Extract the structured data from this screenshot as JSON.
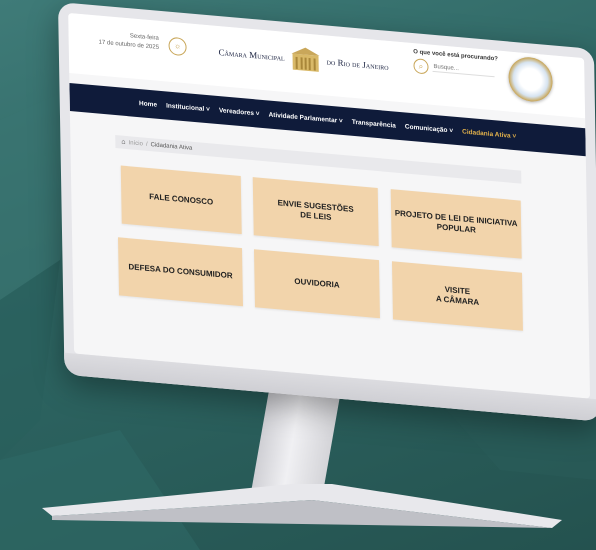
{
  "header": {
    "weekday": "Sexta-feira",
    "date": "17 de outubro de 2025",
    "logo_left": "Câmara Municipal",
    "logo_right": "do Rio de Janeiro",
    "search_prompt": "O que você está procurando?",
    "search_placeholder": "Busque..."
  },
  "nav": {
    "items": [
      {
        "label": "Home"
      },
      {
        "label": "Institucional ˅"
      },
      {
        "label": "Vereadores ˅"
      },
      {
        "label": "Atividade Parlamentar ˅"
      },
      {
        "label": "Transparência"
      },
      {
        "label": "Comunicação ˅"
      },
      {
        "label": "Cidadania Ativa ˅"
      }
    ],
    "active_color": "#e2b14b",
    "bar_color": "#0f1b3a"
  },
  "breadcrumb": {
    "home_icon": "home-icon",
    "link": "Início",
    "separator": "/",
    "current": "Cidadania Ativa"
  },
  "tiles": [
    {
      "line1": "FALE CONOSCO",
      "line2": ""
    },
    {
      "line1": "ENVIE SUGESTÕES",
      "line2": "DE LEIS"
    },
    {
      "line1": "PROJETO DE LEI DE INICIATIVA",
      "line2": "POPULAR"
    },
    {
      "line1": "DEFESA DO CONSUMIDOR",
      "line2": ""
    },
    {
      "line1": "OUVIDORIA",
      "line2": ""
    },
    {
      "line1": "VISITE",
      "line2": "A CÂMARA"
    }
  ],
  "colors": {
    "tile": "#f2d4ab",
    "background": "#2d6562",
    "accent_gold": "#c9a75a"
  }
}
